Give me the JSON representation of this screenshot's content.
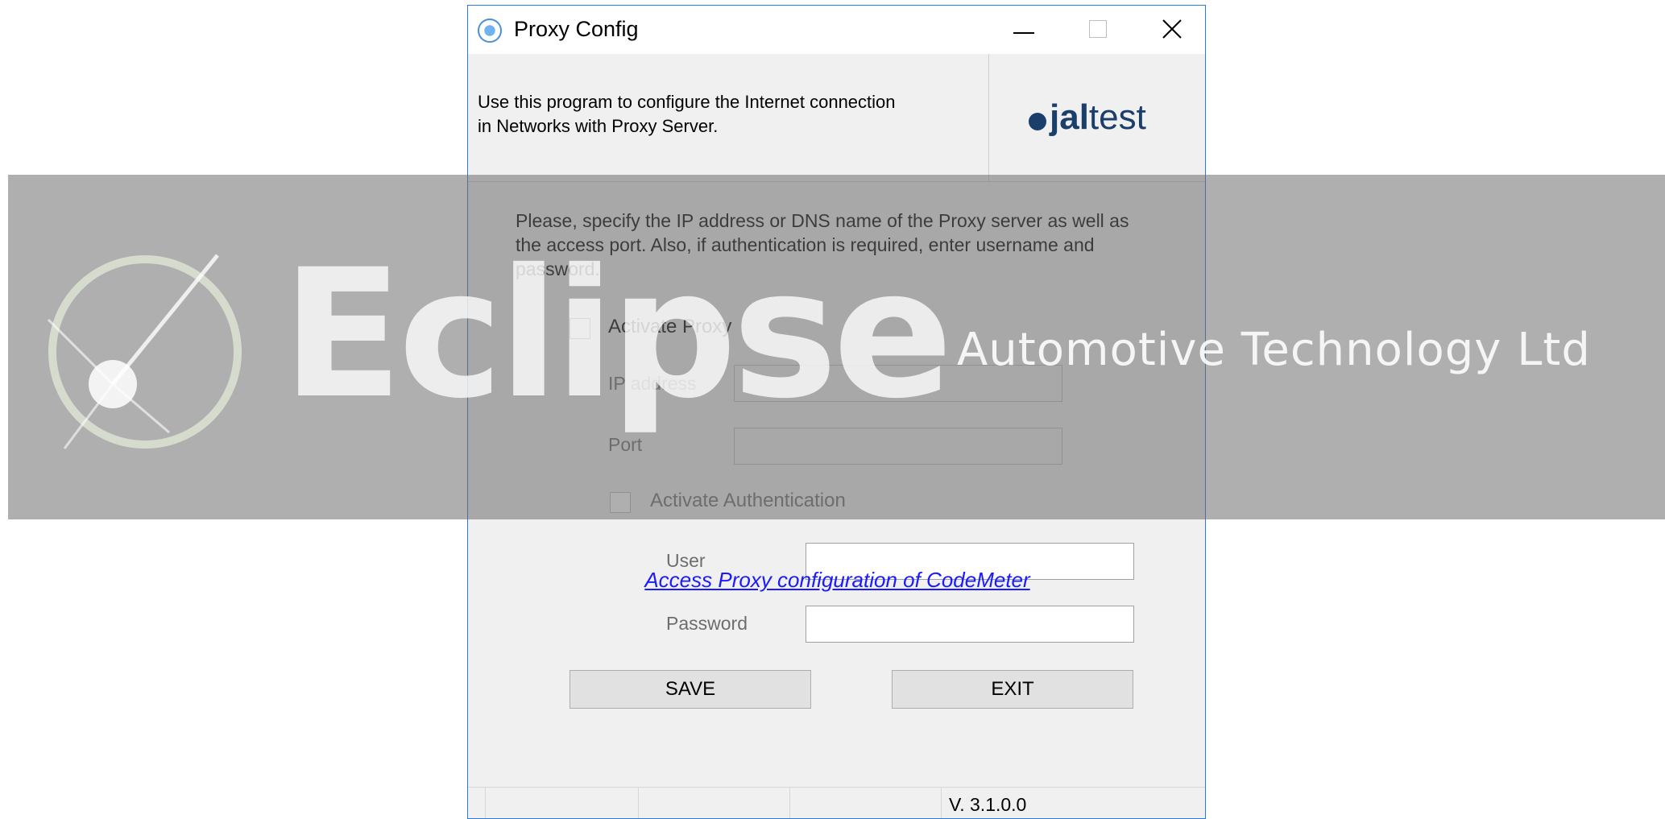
{
  "window": {
    "title": "Proxy Config",
    "controls": {
      "minimize": "minimize",
      "maximize": "maximize",
      "close": "close"
    }
  },
  "header": {
    "description": "Use this program to configure the Internet connection in Networks with Proxy Server.",
    "logo_prefix": "jal",
    "logo_suffix": "test"
  },
  "main": {
    "instructions": "Please, specify the IP address or DNS name of the Proxy server as well as the access port. Also, if authentication is required, enter username and password.",
    "activate_proxy_label": "Activate Proxy",
    "activate_proxy_checked": false,
    "ip_label": "IP address",
    "ip_value": "",
    "port_label": "Port",
    "port_value": "",
    "activate_auth_label": "Activate Authentication",
    "activate_auth_checked": false,
    "user_label": "User",
    "user_value": "",
    "password_label": "Password",
    "password_value": ""
  },
  "buttons": {
    "save": "SAVE",
    "exit": "EXIT"
  },
  "link": "Access Proxy configuration of CodeMeter",
  "statusbar": {
    "version": "V. 3.1.0.0"
  },
  "watermark": {
    "word": "Eclipse",
    "subtitle": "Automotive Technology Ltd"
  },
  "colors": {
    "accent": "#2b79d8",
    "link": "#1a1aff",
    "logo": "#1b3f6b"
  }
}
